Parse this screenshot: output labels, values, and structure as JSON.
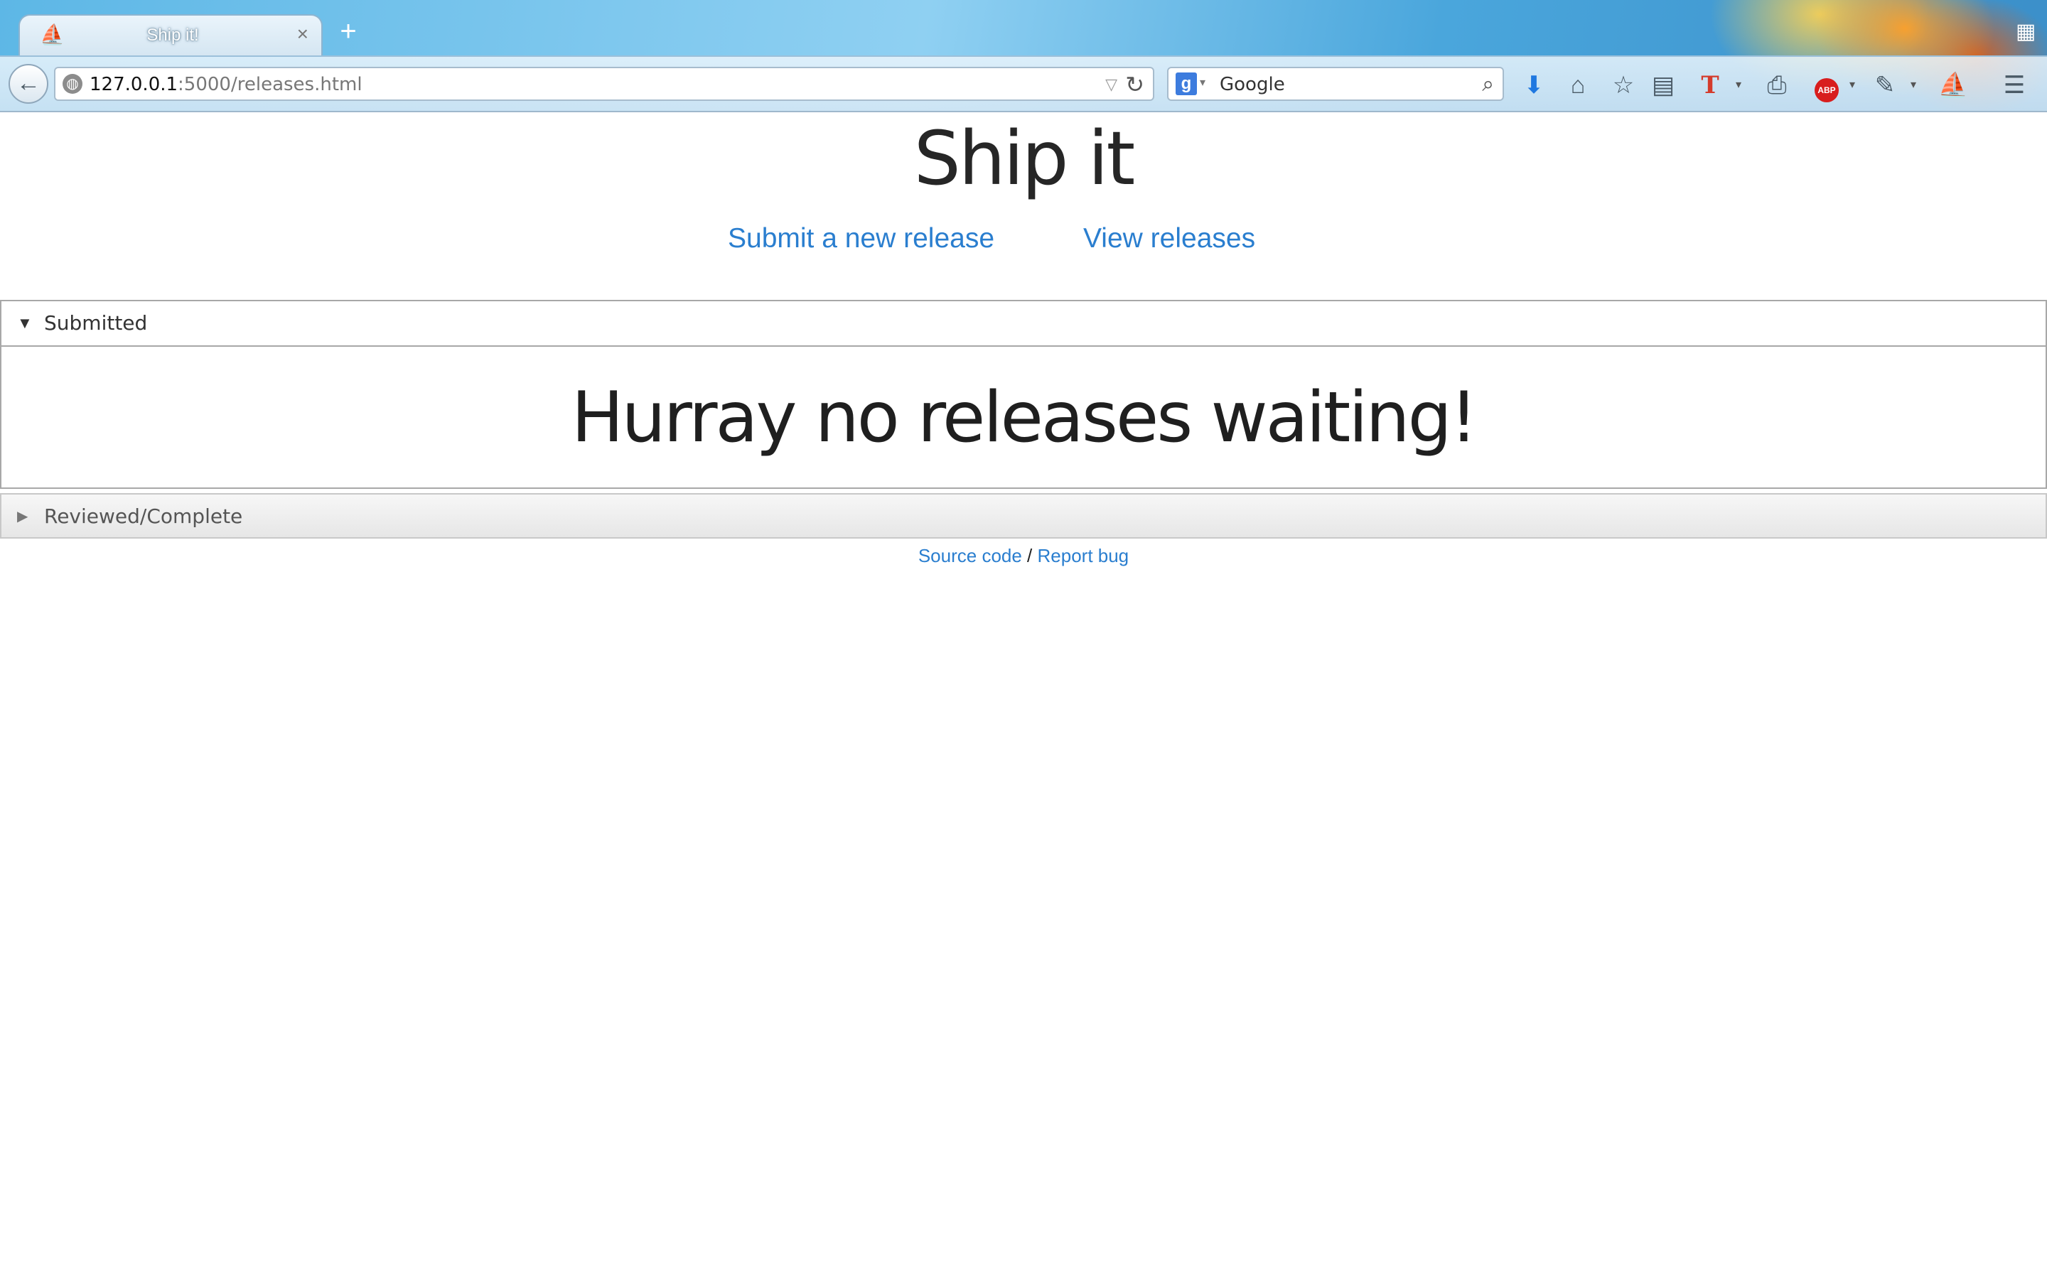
{
  "browser": {
    "tab": {
      "title": "Ship it!",
      "close_glyph": "×",
      "favicon_icon": "ship-icon"
    },
    "new_tab_glyph": "+",
    "url": {
      "host": "127.0.0.1",
      "path": ":5000/releases.html"
    },
    "search": {
      "engine_glyph": "g",
      "placeholder": "Google"
    },
    "toolbar_icons": [
      "download-icon",
      "home-icon",
      "bookmark-star-icon",
      "reading-list-icon",
      "text-tool-icon",
      "print-icon",
      "adblock-icon",
      "tools-icon",
      "ship-icon",
      "menu-icon"
    ],
    "abp_label": "ABP"
  },
  "page": {
    "title": "Ship it",
    "nav": {
      "submit_label": "Submit a new release",
      "view_label": "View releases"
    },
    "submitted_panel": {
      "label": "Submitted",
      "expanded": true,
      "empty_message": "Hurray no releases waiting!"
    },
    "reviewed_panel": {
      "label": "Reviewed/Complete",
      "expanded": false
    },
    "footer": {
      "source_label": "Source code",
      "separator": " / ",
      "bug_label": "Report bug"
    }
  },
  "colors": {
    "link": "#2a7ecf",
    "title_text": "#262626",
    "panel_border": "#a8a8a8"
  }
}
